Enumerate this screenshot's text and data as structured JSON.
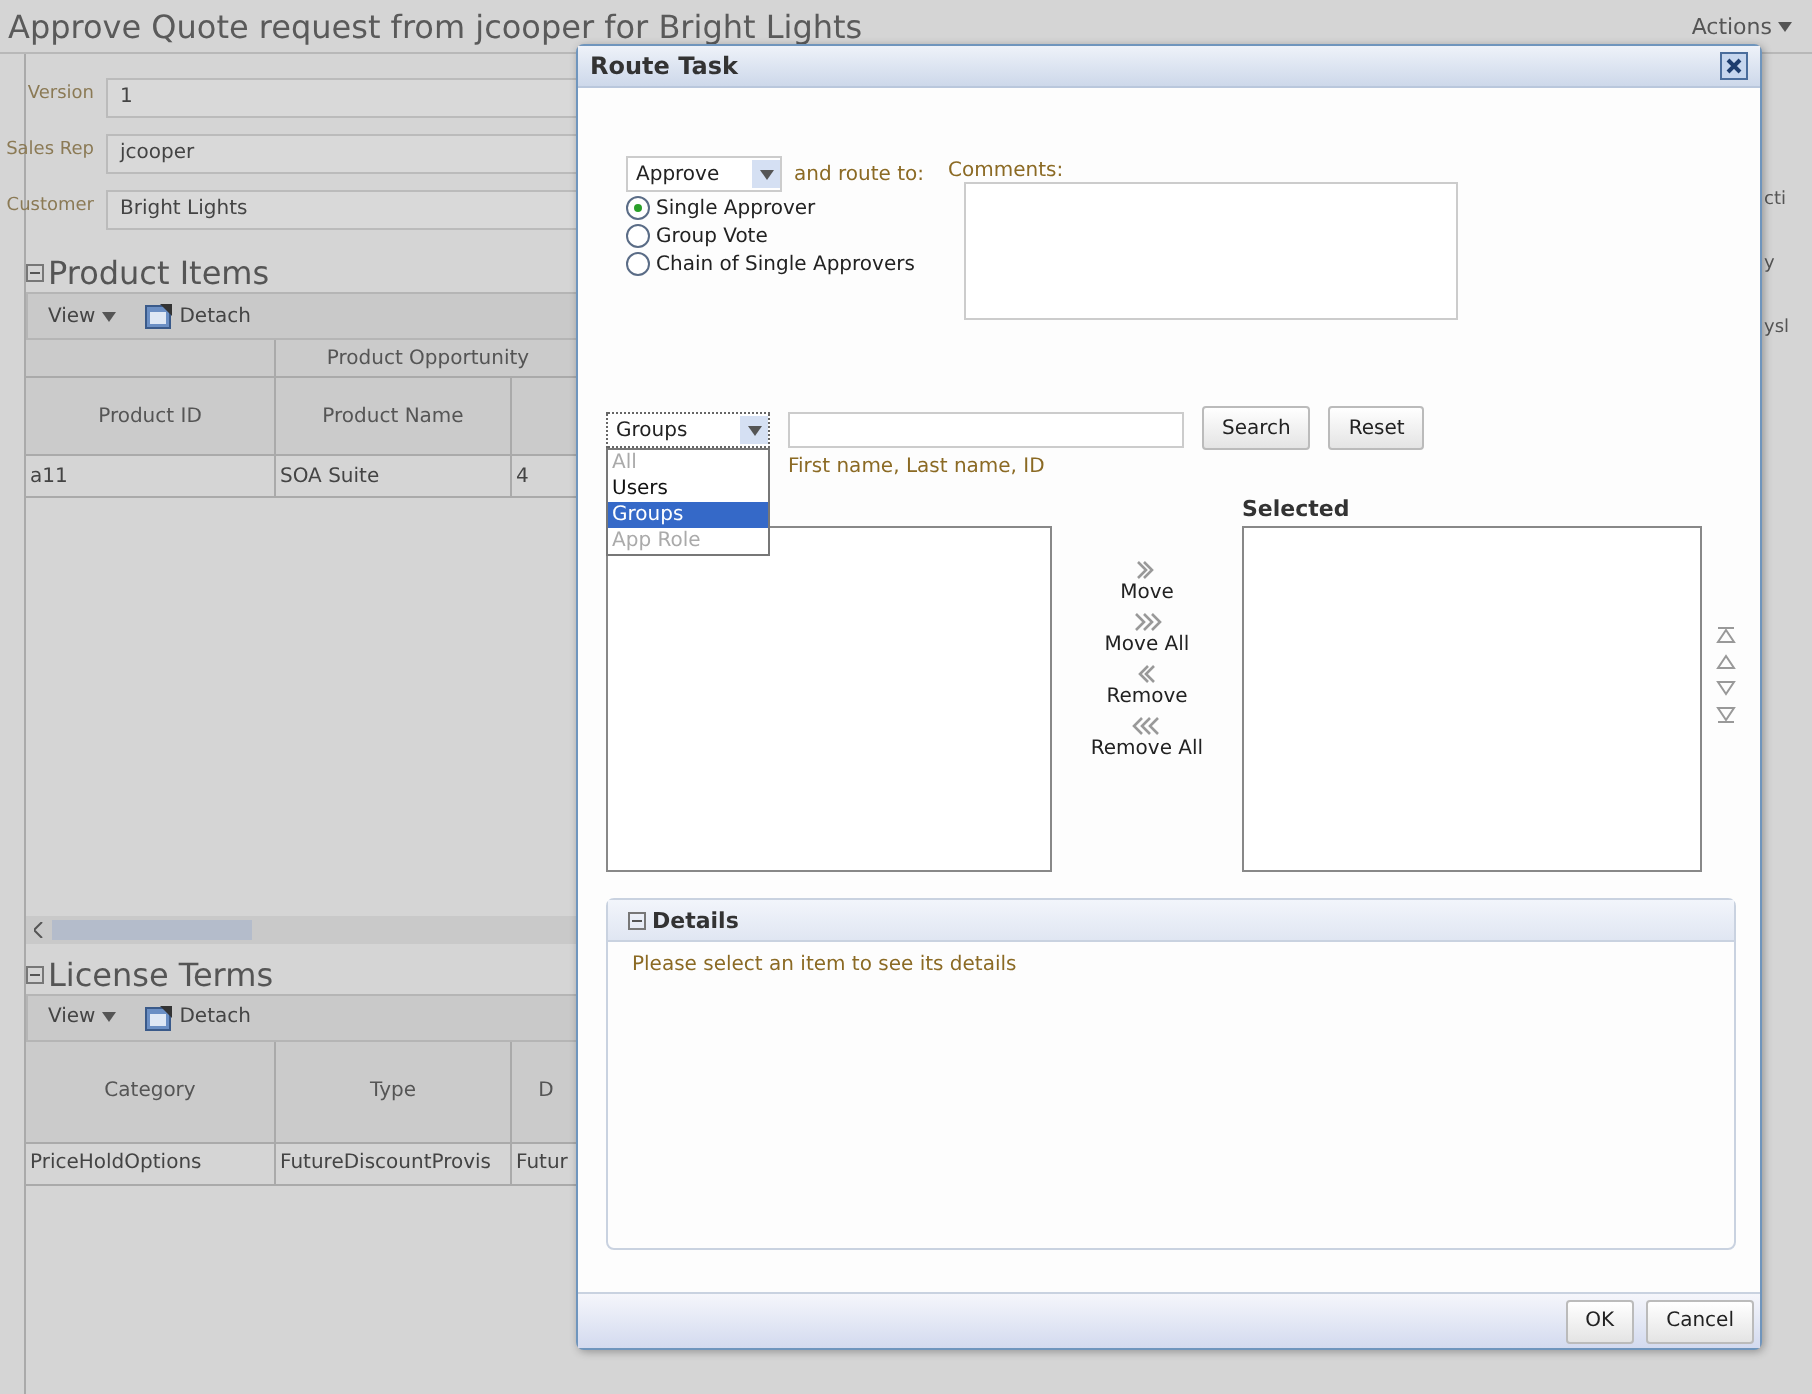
{
  "page": {
    "title": "Approve Quote request from jcooper for Bright Lights",
    "actions_menu": "Actions"
  },
  "form_fields": [
    {
      "label": "Version",
      "value": "1"
    },
    {
      "label": "Sales Rep",
      "value": "jcooper"
    },
    {
      "label": "Customer",
      "value": "Bright Lights"
    }
  ],
  "product_items": {
    "title": "Product Items",
    "expanded": true,
    "view": "View",
    "detach": "Detach",
    "group_header": "Product Opportunity",
    "columns": [
      "Product ID",
      "Product Name"
    ],
    "rows": [
      [
        "a11",
        "SOA Suite",
        "4"
      ]
    ]
  },
  "license_terms": {
    "title": "License Terms",
    "expanded": true,
    "view": "View",
    "detach": "Detach",
    "columns": [
      "Category",
      "Type",
      "D"
    ],
    "rows": [
      [
        "PriceHoldOptions",
        "FutureDiscountProvis",
        "Futur"
      ]
    ]
  },
  "right_edge": [
    "cti",
    "y",
    "ysl"
  ],
  "dialog": {
    "title": "Route Task",
    "outcome": "Approve",
    "route_label": "and route to:",
    "routing_options": [
      {
        "label": "Single Approver",
        "selected": true
      },
      {
        "label": "Group Vote",
        "selected": false
      },
      {
        "label": "Chain of Single Approvers",
        "selected": false
      }
    ],
    "comments_label": "Comments:",
    "search": {
      "type_value": "Groups",
      "hint": "First name, Last name, ID",
      "buttons": [
        "Search",
        "Reset"
      ],
      "type_options": [
        {
          "label": "All",
          "selected": false,
          "disabled": true
        },
        {
          "label": "Users",
          "selected": false,
          "disabled": false
        },
        {
          "label": "Groups",
          "selected": true,
          "disabled": false
        },
        {
          "label": "App Role",
          "selected": false,
          "disabled": true
        }
      ]
    },
    "shuttle": {
      "selected_label": "Selected",
      "actions": [
        {
          "label": "Move",
          "kind": "move"
        },
        {
          "label": "Move All",
          "kind": "move_all"
        },
        {
          "label": "Remove",
          "kind": "remove"
        },
        {
          "label": "Remove All",
          "kind": "remove_all"
        }
      ]
    },
    "details": {
      "title": "Details",
      "expanded": true,
      "message": "Please select an item to see its details"
    },
    "buttons": [
      "OK",
      "Cancel"
    ]
  }
}
